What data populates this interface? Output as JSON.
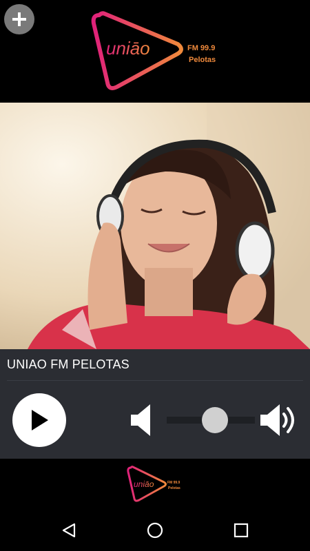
{
  "logo": {
    "brand": "uniāo",
    "frequency": "FM 99.9",
    "city": "Pelotas",
    "gradient_start": "#e0217a",
    "gradient_end": "#f08a3c"
  },
  "player": {
    "station_name": "UNIAO FM PELOTAS",
    "volume_level": 0.55
  },
  "icons": {
    "add": "plus-icon",
    "play": "play-icon",
    "volume_low": "volume-low-icon",
    "volume_high": "volume-high-icon",
    "nav_back": "back-triangle-icon",
    "nav_home": "home-circle-icon",
    "nav_recents": "recents-square-icon"
  },
  "colors": {
    "background": "#000000",
    "panel": "#2b2d33",
    "slider_thumb": "#d0d0d0"
  }
}
